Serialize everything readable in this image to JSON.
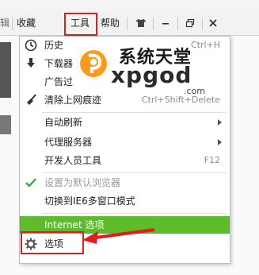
{
  "toolbar": {
    "left_fragment": "辑",
    "favorites": "收藏",
    "tools": "工具",
    "help": "帮助"
  },
  "menu": {
    "items": [
      {
        "label": "历史",
        "shortcut": "Ctrl+H",
        "icon": "clock-icon"
      },
      {
        "label": "下载器",
        "shortcut": "",
        "icon": "download-icon"
      },
      {
        "label": "广告过",
        "shortcut": "",
        "icon": ""
      },
      {
        "label": "清除上网痕迹",
        "shortcut": "Ctrl+Shift+Delete",
        "icon": "broom-icon"
      },
      {
        "label": "自动刷新",
        "shortcut": "",
        "icon": "",
        "submenu": true
      },
      {
        "label": "代理服务器",
        "shortcut": "",
        "icon": "",
        "submenu": true
      },
      {
        "label": "开发人员工具",
        "shortcut": "F12",
        "icon": ""
      },
      {
        "label": "设置为默认浏览器",
        "shortcut": "",
        "icon": "checkmark-icon",
        "disabled": true
      },
      {
        "label": "切换到IE6多窗口模式",
        "shortcut": "",
        "icon": ""
      },
      {
        "label": "Internet 选项",
        "shortcut": "",
        "icon": "",
        "highlighted": true
      },
      {
        "label": "选项",
        "shortcut": "",
        "icon": "gear-icon"
      }
    ]
  },
  "watermark": {
    "line1": "系统天堂",
    "line2": "xpgod",
    "line3": ".com"
  },
  "colors": {
    "highlight_green": "#5dbb2c",
    "annotation_red": "#e21b1b",
    "watermark_orange": "#ff9a1f"
  }
}
